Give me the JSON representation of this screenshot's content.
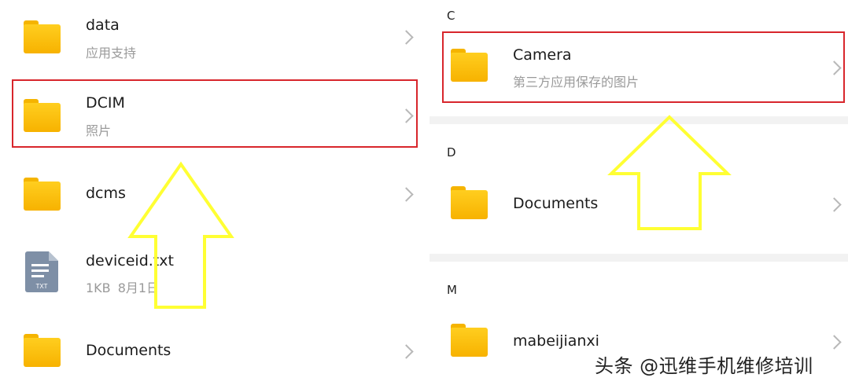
{
  "left_panel": {
    "items": [
      {
        "name": "data",
        "subtitle": "应用支持",
        "icon": "folder-icon"
      },
      {
        "name": "DCIM",
        "subtitle": "照片",
        "icon": "folder-icon"
      },
      {
        "name": "dcms",
        "subtitle": "",
        "icon": "folder-icon"
      },
      {
        "name": "deviceid.txt",
        "subtitle": "1KB   8月1日",
        "icon": "txt-file-icon",
        "icon_label": "TXT"
      },
      {
        "name": "Documents",
        "subtitle": "",
        "icon": "folder-icon"
      }
    ]
  },
  "right_panel": {
    "sections": [
      {
        "letter": "C",
        "items": [
          {
            "name": "Camera",
            "subtitle": "第三方应用保存的图片",
            "icon": "folder-icon"
          }
        ]
      },
      {
        "letter": "D",
        "items": [
          {
            "name": "Documents",
            "subtitle": "",
            "icon": "folder-icon"
          }
        ]
      },
      {
        "letter": "M",
        "items": [
          {
            "name": "mabeijianxi",
            "subtitle": "",
            "icon": "folder-icon"
          }
        ]
      }
    ]
  },
  "annotations": {
    "highlight_color": "#d8262c",
    "arrow_color": "#ffff33"
  },
  "watermark": "头条 @迅维手机维修培训",
  "colors": {
    "folder": "#f7b200",
    "file_icon": "#7e8fa6",
    "chevron": "#b8b8b8"
  }
}
